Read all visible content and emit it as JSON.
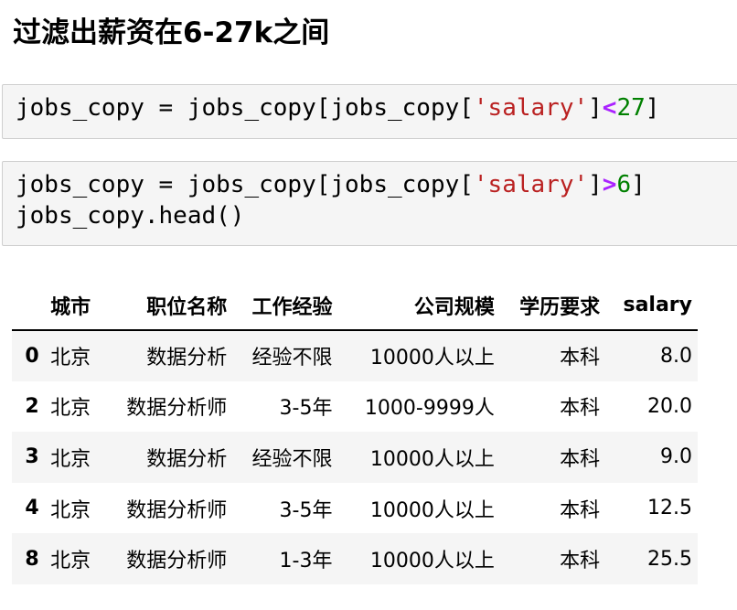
{
  "heading": "过滤出薪资在6-27k之间",
  "cells": [
    {
      "lines": [
        [
          {
            "t": "jobs_copy = jobs_copy[jobs_copy[",
            "k": "plain"
          },
          {
            "t": "'salary'",
            "k": "str"
          },
          {
            "t": "]",
            "k": "plain"
          },
          {
            "t": "<",
            "k": "op"
          },
          {
            "t": "27",
            "k": "num"
          },
          {
            "t": "]",
            "k": "plain"
          }
        ]
      ]
    },
    {
      "lines": [
        [
          {
            "t": "jobs_copy = jobs_copy[jobs_copy[",
            "k": "plain"
          },
          {
            "t": "'salary'",
            "k": "str"
          },
          {
            "t": "]",
            "k": "plain"
          },
          {
            "t": ">",
            "k": "op"
          },
          {
            "t": "6",
            "k": "num"
          },
          {
            "t": "]",
            "k": "plain"
          }
        ],
        [
          {
            "t": "jobs_copy.head()",
            "k": "plain"
          }
        ]
      ]
    }
  ],
  "colors": {
    "string": "#ba2121",
    "operator": "#aa22ff",
    "number": "#008000",
    "cell_background": "#f5f5f5",
    "row_stripe": "#f5f5f5"
  },
  "table": {
    "columns": [
      "城市",
      "职位名称",
      "工作经验",
      "公司规模",
      "学历要求",
      "salary"
    ],
    "rows": [
      {
        "index": "0",
        "values": [
          "北京",
          "数据分析",
          "经验不限",
          "10000人以上",
          "本科",
          "8.0"
        ]
      },
      {
        "index": "2",
        "values": [
          "北京",
          "数据分析师",
          "3-5年",
          "1000-9999人",
          "本科",
          "20.0"
        ]
      },
      {
        "index": "3",
        "values": [
          "北京",
          "数据分析",
          "经验不限",
          "10000人以上",
          "本科",
          "9.0"
        ]
      },
      {
        "index": "4",
        "values": [
          "北京",
          "数据分析师",
          "3-5年",
          "10000人以上",
          "本科",
          "12.5"
        ]
      },
      {
        "index": "8",
        "values": [
          "北京",
          "数据分析师",
          "1-3年",
          "10000人以上",
          "本科",
          "25.5"
        ]
      }
    ]
  }
}
